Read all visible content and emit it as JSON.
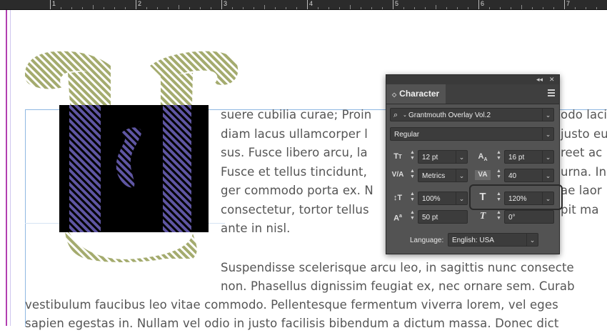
{
  "ruler": {
    "numbers": [
      "1",
      "2",
      "3",
      "4",
      "5",
      "6",
      "7"
    ]
  },
  "colors": {
    "accent_guide": "#b23fb0",
    "dropcap_olive": "#a4ab6e",
    "dropcap_purple": "#5f56a3",
    "panel_bg": "#535353"
  },
  "body_text": {
    "lines_right": [
      "suere cubilia curae; Proin",
      "diam lacus ullamcorper l",
      "sus. Fusce libero arcu, la",
      "Fusce et tellus tincidunt,",
      "ger commodo porta ex. N",
      "consectetur, tortor tellus",
      "ante in nisl."
    ],
    "lines_far_right": [
      "odo laci",
      "justo eu",
      "reet ac",
      "urna. In",
      "ae laor",
      "pit ma"
    ],
    "paragraph2": [
      "Suspendisse scelerisque arcu leo, in sagittis nunc consecte",
      "non. Phasellus dignissim feugiat ex, nec ornare sem. Curab",
      "vestibulum faucibus leo vitae commodo. Pellentesque fermentum viverra lorem, vel eges",
      "sapien egestas in. Nullam vel odio in justo facilisis bibendum a dictum massa. Donec dict"
    ]
  },
  "panel": {
    "title": "Character",
    "font_family": "Grantmouth Overlay Vol.2",
    "font_style": "Regular",
    "font_size": "12 pt",
    "leading": "16 pt",
    "kerning": "Metrics",
    "tracking": "40",
    "vertical_scale": "100%",
    "horizontal_scale": "120%",
    "baseline_shift": "50 pt",
    "skew": "0°",
    "language_label": "Language:",
    "language": "English: USA",
    "icons": {
      "collapse": "double-chevron-left-icon",
      "close": "close-icon",
      "menu": "hamburger-menu-icon",
      "search": "search-icon",
      "font_size": "font-size-icon",
      "leading": "leading-icon",
      "kerning": "kerning-icon",
      "tracking": "tracking-icon",
      "vertical_scale": "vertical-scale-icon",
      "horizontal_scale": "horizontal-scale-icon",
      "baseline_shift": "baseline-shift-icon",
      "skew": "skew-icon"
    }
  }
}
